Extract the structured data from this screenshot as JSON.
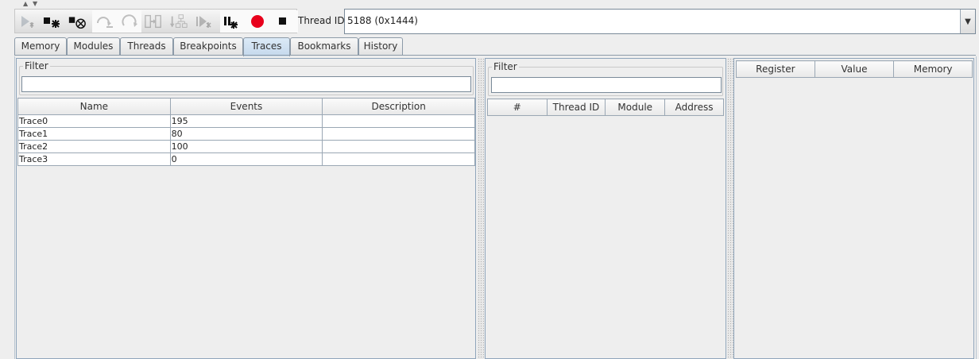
{
  "window": {
    "scroll_arrows": [
      "▲",
      "▼"
    ]
  },
  "toolbar": {
    "buttons": [
      {
        "name": "resume-icon",
        "enabled": false
      },
      {
        "name": "step-into-icon",
        "enabled": true
      },
      {
        "name": "step-instruction-icon",
        "enabled": true
      },
      {
        "name": "step-over-icon",
        "enabled": false
      },
      {
        "name": "step-out-icon",
        "enabled": false
      },
      {
        "name": "run-to-cursor-icon",
        "enabled": false
      },
      {
        "name": "step-back-icon",
        "enabled": false
      },
      {
        "name": "resume-back-icon",
        "enabled": false
      },
      {
        "name": "pause-icon",
        "enabled": true
      },
      {
        "name": "record-icon",
        "enabled": true
      },
      {
        "name": "stop-icon",
        "enabled": true
      }
    ],
    "thread_label": "Thread ID",
    "thread_value": "5188 (0x1444)"
  },
  "tabs": [
    {
      "label": "Memory",
      "active": false
    },
    {
      "label": "Modules",
      "active": false
    },
    {
      "label": "Threads",
      "active": false
    },
    {
      "label": "Breakpoints",
      "active": false
    },
    {
      "label": "Traces",
      "active": true
    },
    {
      "label": "Bookmarks",
      "active": false
    },
    {
      "label": "History",
      "active": false
    }
  ],
  "traces_panel": {
    "filter_label": "Filter",
    "filter_value": "",
    "columns": [
      "Name",
      "Events",
      "Description"
    ],
    "rows": [
      {
        "name": "Trace0",
        "events": "195",
        "description": ""
      },
      {
        "name": "Trace1",
        "events": "80",
        "description": ""
      },
      {
        "name": "Trace2",
        "events": "100",
        "description": ""
      },
      {
        "name": "Trace3",
        "events": "0",
        "description": ""
      }
    ]
  },
  "events_panel": {
    "filter_label": "Filter",
    "filter_value": "",
    "columns": [
      "#",
      "Thread ID",
      "Module",
      "Address"
    ]
  },
  "registers_panel": {
    "columns": [
      "Register",
      "Value",
      "Memory"
    ]
  },
  "colors": {
    "record_red": "#e8001c",
    "active_tab": "#c4d8ec"
  }
}
